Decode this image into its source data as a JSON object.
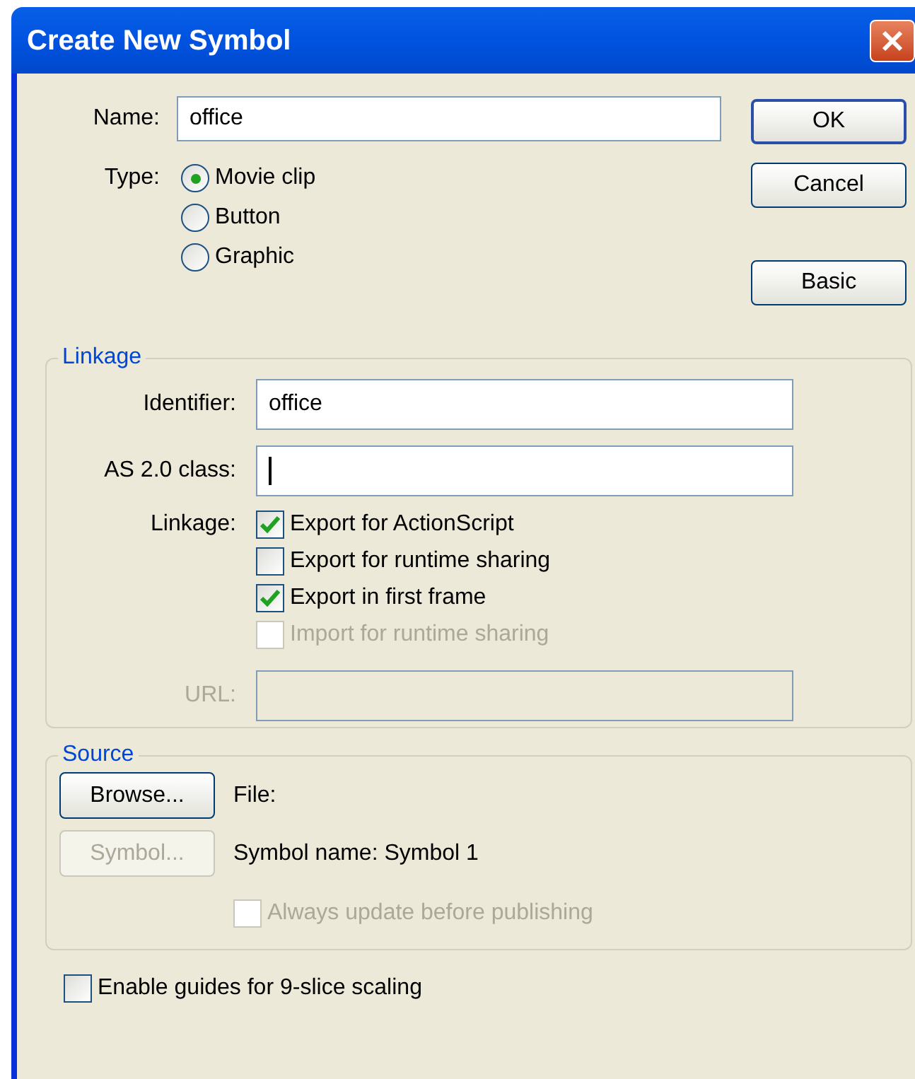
{
  "window": {
    "title": "Create New Symbol"
  },
  "name_field": {
    "label": "Name:",
    "value": "office"
  },
  "type": {
    "label": "Type:",
    "options": [
      {
        "label": "Movie clip",
        "selected": true
      },
      {
        "label": "Button",
        "selected": false
      },
      {
        "label": "Graphic",
        "selected": false
      }
    ]
  },
  "buttons": [
    {
      "label": "OK",
      "default": true
    },
    {
      "label": "Cancel",
      "default": false
    },
    {
      "label": "Basic",
      "default": false
    }
  ],
  "linkage": {
    "title": "Linkage",
    "fields": [
      {
        "label": "Identifier:",
        "value": "office",
        "focused": false
      },
      {
        "label": "AS 2.0 class:",
        "focused": true
      }
    ],
    "options_label": "Linkage:",
    "options": [
      {
        "label": "Export for ActionScript",
        "checked": true,
        "disabled": false
      },
      {
        "label": "Export for runtime sharing",
        "checked": false,
        "disabled": false
      },
      {
        "label": "Export in first frame",
        "checked": true,
        "disabled": false
      },
      {
        "label": "Import for runtime sharing",
        "checked": false,
        "disabled": true
      }
    ],
    "url": {
      "label": "URL:",
      "disabled": true
    }
  },
  "source": {
    "title": "Source",
    "browse_button": {
      "label": "Browse...",
      "disabled": false
    },
    "file_label": "File:",
    "symbol_button": {
      "label": "Symbol...",
      "disabled": true
    },
    "symbol_name": "Symbol name: Symbol 1",
    "always_update": {
      "label": "Always update before publishing",
      "checked": false,
      "disabled": true
    }
  },
  "guides": {
    "label": "Enable guides for 9-slice scaling",
    "checked": false,
    "disabled": false
  }
}
